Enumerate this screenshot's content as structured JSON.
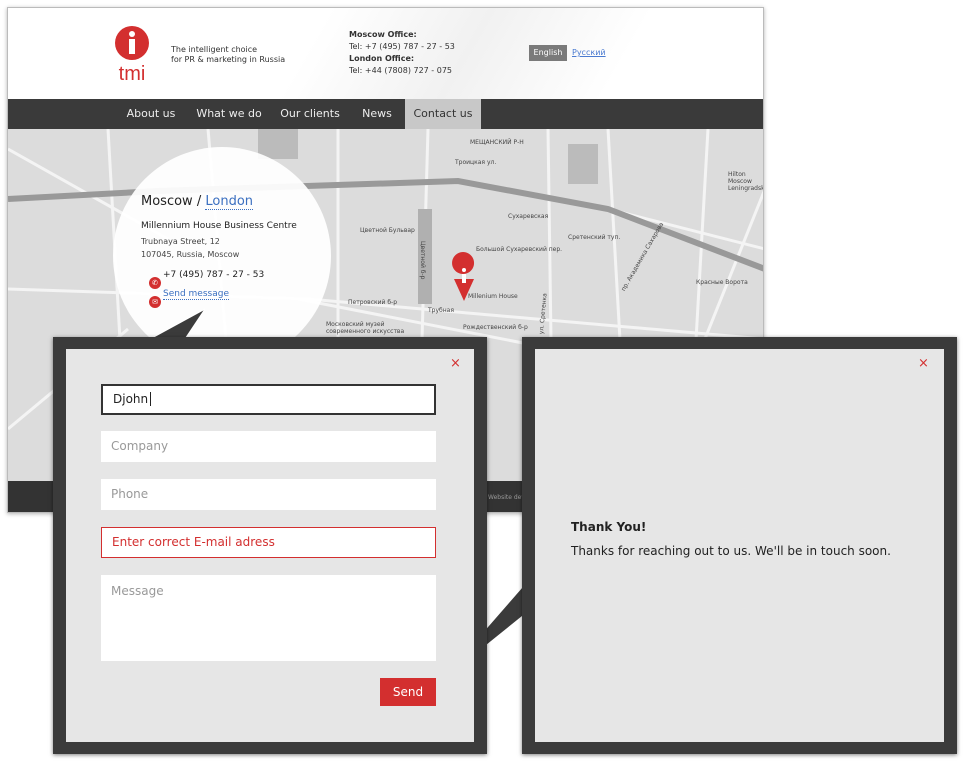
{
  "header": {
    "logo_text": "tmi",
    "tagline_line1": "The intelligent choice",
    "tagline_line2": "for PR & marketing in Russia",
    "moscow_label": "Moscow Office:",
    "moscow_tel": "Tel: +7 (495) 787 - 27 - 53",
    "london_label": "London Office:",
    "london_tel": "Tel: +44 (7808) 727 - 075",
    "lang_active": "English",
    "lang_other": "Русский"
  },
  "nav": {
    "items": [
      {
        "label": "About us"
      },
      {
        "label": "What we do"
      },
      {
        "label": "Our clients"
      },
      {
        "label": "News"
      },
      {
        "label": "Contact us",
        "active": true
      }
    ]
  },
  "map": {
    "labels": [
      "МЕЩАНСКИЙ Р-Н",
      "Троицкая ул.",
      "Сухаревская",
      "Цветной Бульвар",
      "Цветной б-р",
      "Millenium House",
      "Трубная",
      "Петровский б-р",
      "Рождественский б-р",
      "Московский музей современного искусства",
      "Большой Сухаревский пер.",
      "Сретенский туп.",
      "Красные Ворота",
      "Hilton Moscow Leningradskaya",
      "пр. Академика Сахарова",
      "ул. Сретенка"
    ]
  },
  "contact": {
    "city_active": "Moscow",
    "separator": "/",
    "city_other": "London",
    "building": "Millennium House Business Centre",
    "street": "Trubnaya Street, 12",
    "postcode": "107045, Russia, Moscow",
    "phone": "+7 (495) 787 - 27 - 53",
    "send_message": "Send message"
  },
  "footer": {
    "link": "Website dev"
  },
  "form": {
    "name_value": "Djohn",
    "company_placeholder": "Company",
    "phone_placeholder": "Phone",
    "email_error": "Enter correct E-mail adress",
    "message_placeholder": "Message",
    "send_label": "Send",
    "close": "×"
  },
  "thanks": {
    "title": "Thank You!",
    "text": "Thanks for reaching out to us. We'll be in touch soon.",
    "close": "×"
  },
  "colors": {
    "accent": "#d32f2f",
    "nav": "#3a3a3a",
    "link": "#3a6fc0"
  }
}
